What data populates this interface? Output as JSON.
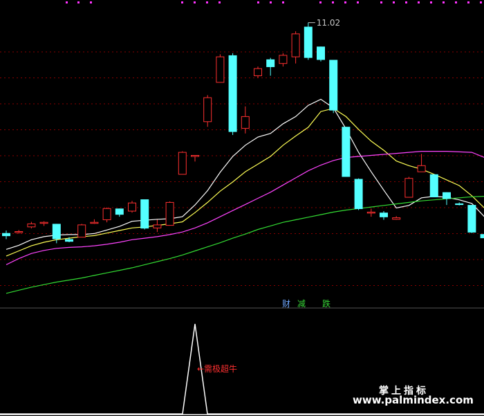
{
  "chart_data": [
    {
      "type": "candlestick",
      "price_axis": {
        "min": 5.5,
        "max": 11.3
      },
      "max_label": "11.02",
      "candles": [
        {
          "o": 6.9,
          "h": 6.95,
          "l": 6.78,
          "c": 6.84
        },
        {
          "o": 6.92,
          "h": 6.96,
          "l": 6.89,
          "c": 6.93
        },
        {
          "o": 7.02,
          "h": 7.12,
          "l": 6.99,
          "c": 7.08
        },
        {
          "o": 7.09,
          "h": 7.13,
          "l": 7.04,
          "c": 7.11
        },
        {
          "o": 7.08,
          "h": 7.08,
          "l": 6.7,
          "c": 6.78
        },
        {
          "o": 6.78,
          "h": 6.82,
          "l": 6.72,
          "c": 6.73
        },
        {
          "o": 6.82,
          "h": 7.08,
          "l": 6.82,
          "c": 7.06
        },
        {
          "o": 7.09,
          "h": 7.17,
          "l": 7.08,
          "c": 7.11
        },
        {
          "o": 7.16,
          "h": 7.4,
          "l": 7.11,
          "c": 7.38
        },
        {
          "o": 7.38,
          "h": 7.38,
          "l": 7.22,
          "c": 7.26
        },
        {
          "o": 7.33,
          "h": 7.53,
          "l": 7.3,
          "c": 7.49
        },
        {
          "o": 7.56,
          "h": 7.56,
          "l": 6.97,
          "c": 6.99
        },
        {
          "o": 7.0,
          "h": 7.16,
          "l": 6.92,
          "c": 7.06
        },
        {
          "o": 7.05,
          "h": 7.52,
          "l": 7.05,
          "c": 7.5
        },
        {
          "o": 8.05,
          "h": 8.5,
          "l": 8.05,
          "c": 8.48
        },
        {
          "o": 8.42,
          "h": 8.42,
          "l": 8.3,
          "c": 8.42
        },
        {
          "o": 9.08,
          "h": 9.6,
          "l": 8.98,
          "c": 9.55
        },
        {
          "o": 9.85,
          "h": 10.4,
          "l": 9.85,
          "c": 10.35
        },
        {
          "o": 10.38,
          "h": 10.42,
          "l": 8.82,
          "c": 8.88
        },
        {
          "o": 8.95,
          "h": 9.38,
          "l": 8.85,
          "c": 9.18
        },
        {
          "o": 9.98,
          "h": 10.16,
          "l": 9.94,
          "c": 10.12
        },
        {
          "o": 10.3,
          "h": 10.33,
          "l": 9.98,
          "c": 10.15
        },
        {
          "o": 10.22,
          "h": 10.42,
          "l": 10.16,
          "c": 10.38
        },
        {
          "o": 10.35,
          "h": 10.85,
          "l": 10.22,
          "c": 10.8
        },
        {
          "o": 10.94,
          "h": 11.02,
          "l": 10.29,
          "c": 10.33
        },
        {
          "o": 10.55,
          "h": 10.55,
          "l": 10.26,
          "c": 10.29
        },
        {
          "o": 10.29,
          "h": 9.58,
          "l": 9.25,
          "c": 9.3
        },
        {
          "o": 8.98,
          "h": 8.98,
          "l": 8.0,
          "c": 8.0
        },
        {
          "o": 7.96,
          "h": 7.97,
          "l": 7.35,
          "c": 7.37
        },
        {
          "o": 7.3,
          "h": 7.38,
          "l": 7.22,
          "c": 7.31
        },
        {
          "o": 7.3,
          "h": 7.33,
          "l": 7.16,
          "c": 7.21
        },
        {
          "o": 7.17,
          "h": 7.23,
          "l": 7.16,
          "c": 7.2
        },
        {
          "o": 7.6,
          "h": 8.0,
          "l": 7.6,
          "c": 7.97
        },
        {
          "o": 8.1,
          "h": 8.45,
          "l": 8.1,
          "c": 8.22
        },
        {
          "o": 8.05,
          "h": 8.05,
          "l": 7.6,
          "c": 7.6
        },
        {
          "o": 7.7,
          "h": 7.7,
          "l": 7.45,
          "c": 7.57
        },
        {
          "o": 7.48,
          "h": 7.5,
          "l": 7.44,
          "c": 7.45
        },
        {
          "o": 7.45,
          "h": 7.45,
          "l": 6.9,
          "c": 6.91
        },
        {
          "o": 6.88,
          "h": 7.0,
          "l": 6.78,
          "c": 6.8
        },
        {
          "o": 6.78,
          "h": 6.86,
          "l": 6.7,
          "c": 6.74
        }
      ],
      "moving_averages": [
        {
          "color": "#ffffff",
          "values": [
            6.58,
            6.66,
            6.77,
            6.83,
            6.86,
            6.87,
            6.87,
            6.89,
            6.96,
            7.03,
            7.13,
            7.15,
            7.17,
            7.18,
            7.22,
            7.45,
            7.73,
            8.09,
            8.4,
            8.62,
            8.78,
            8.85,
            9.04,
            9.18,
            9.4,
            9.52,
            9.35,
            8.94,
            8.48,
            8.1,
            7.74,
            7.39,
            7.44,
            7.59,
            7.62,
            7.6,
            7.55,
            7.48,
            7.22,
            6.92
          ]
        },
        {
          "color": "#ffff55",
          "values": [
            6.45,
            6.55,
            6.65,
            6.72,
            6.77,
            6.8,
            6.83,
            6.85,
            6.9,
            6.95,
            7.0,
            7.02,
            7.05,
            7.08,
            7.12,
            7.3,
            7.5,
            7.72,
            7.9,
            8.1,
            8.25,
            8.4,
            8.62,
            8.8,
            8.97,
            9.28,
            9.34,
            9.18,
            8.93,
            8.7,
            8.52,
            8.31,
            8.22,
            8.15,
            8.05,
            7.94,
            7.83,
            7.63,
            7.39,
            7.26
          ]
        },
        {
          "color": "#ff44ff",
          "values": [
            6.28,
            6.4,
            6.5,
            6.56,
            6.6,
            6.62,
            6.63,
            6.65,
            6.68,
            6.72,
            6.77,
            6.8,
            6.83,
            6.87,
            6.92,
            7.0,
            7.1,
            7.22,
            7.34,
            7.46,
            7.58,
            7.7,
            7.84,
            7.98,
            8.12,
            8.23,
            8.32,
            8.38,
            8.4,
            8.42,
            8.44,
            8.46,
            8.48,
            8.5,
            8.5,
            8.5,
            8.49,
            8.48,
            8.38,
            8.24
          ]
        },
        {
          "color": "#33dd33",
          "values": [
            5.72,
            5.78,
            5.84,
            5.89,
            5.94,
            5.98,
            6.02,
            6.07,
            6.12,
            6.17,
            6.22,
            6.28,
            6.34,
            6.4,
            6.47,
            6.55,
            6.63,
            6.71,
            6.8,
            6.88,
            6.97,
            7.04,
            7.11,
            7.16,
            7.21,
            7.26,
            7.31,
            7.35,
            7.38,
            7.41,
            7.44,
            7.47,
            7.5,
            7.53,
            7.55,
            7.57,
            7.59,
            7.61,
            7.62,
            7.62
          ]
        }
      ],
      "tags": [
        "财",
        "减",
        "跌"
      ]
    },
    {
      "type": "line",
      "color": "#ffffff",
      "values": [
        0,
        0,
        0,
        0,
        0,
        0,
        0,
        0,
        0,
        0,
        0,
        0,
        0,
        0,
        0,
        1,
        0,
        0,
        0,
        0,
        0,
        0,
        0,
        0,
        0,
        0,
        0,
        0,
        0,
        0,
        0,
        0,
        0,
        0,
        0,
        0,
        0,
        0,
        0,
        0
      ],
      "annotation": "←需极超牛"
    }
  ],
  "watermark": {
    "cn": "掌上指标",
    "url": "www.palmindex.com"
  },
  "colors": {
    "up": "#ff3030",
    "down": "#54ffff",
    "grid": "#8a0000",
    "divider": "#555555",
    "dots": "#ff33ff"
  }
}
